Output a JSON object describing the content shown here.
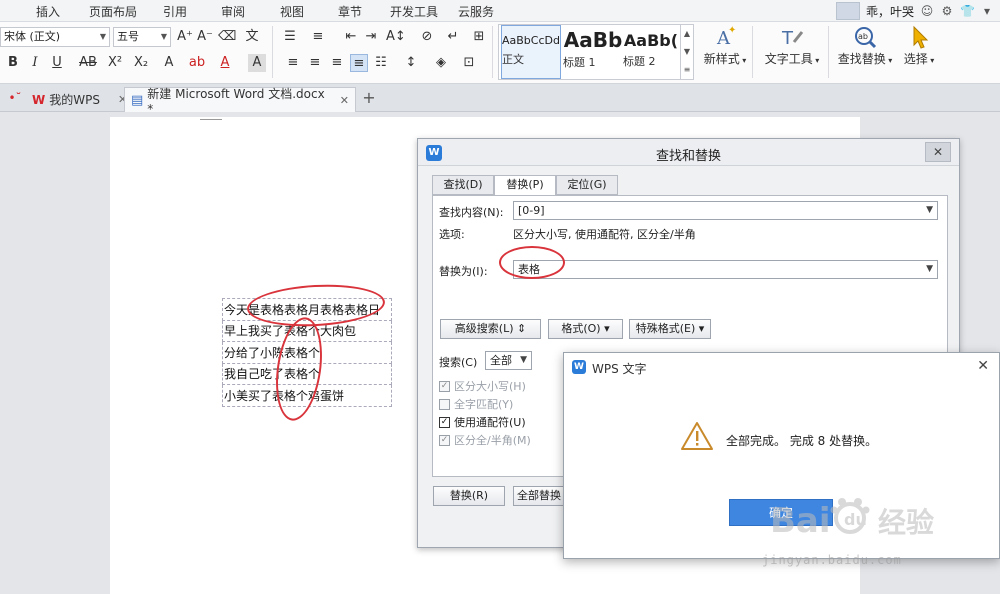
{
  "menu": {
    "items": [
      "插入",
      "页面布局",
      "引用",
      "审阅",
      "视图",
      "章节",
      "开发工具",
      "云服务"
    ],
    "user": "乖，叶哭"
  },
  "ribbon": {
    "font_name": "宋体 (正文)",
    "font_size": "五号",
    "styles": [
      {
        "sample": "AaBbCcDd",
        "label": "正文"
      },
      {
        "sample": "AaBb",
        "label": "标题 1"
      },
      {
        "sample": "AaBb(",
        "label": "标题 2"
      }
    ],
    "new_style": "新样式",
    "text_tools": "文字工具",
    "find_replace": "查找替换",
    "select": "选择"
  },
  "tabs": {
    "wps_home": "我的WPS",
    "document": "新建 Microsoft Word 文档.docx *",
    "add": "+"
  },
  "document": {
    "rows": [
      "今天是表格表格月表格表格日",
      "早上我买了表格个大肉包",
      "分给了小陈表格个",
      "我自己吃了表格个",
      "小美买了表格个鸡蛋饼"
    ]
  },
  "find_dialog": {
    "title": "查找和替换",
    "tab_find": "查找(D)",
    "tab_replace": "替换(P)",
    "tab_goto": "定位(G)",
    "find_label": "查找内容(N):",
    "find_value": "[0-9]",
    "options_label": "选项:",
    "options_value": "区分大小写, 使用通配符, 区分全/半角",
    "replace_label": "替换为(I):",
    "replace_value": "表格",
    "advanced_button": "高级搜索(L)",
    "format_button": "格式(O)",
    "special_button": "特殊格式(E)",
    "search_label": "搜索(C)",
    "search_value": "全部",
    "checkboxes": [
      {
        "label": "区分大小写(H)",
        "checked": true,
        "enabled": false
      },
      {
        "label": "全字匹配(Y)",
        "checked": false,
        "enabled": false
      },
      {
        "label": "使用通配符(U)",
        "checked": true,
        "enabled": true
      },
      {
        "label": "区分全/半角(M)",
        "checked": true,
        "enabled": false
      }
    ],
    "replace_button": "替换(R)",
    "replace_all_button": "全部替换"
  },
  "message_box": {
    "title": "WPS 文字",
    "text": "全部完成。 完成 8 处替换。",
    "ok": "确定"
  },
  "watermark": {
    "brand": "Baidu经验",
    "url": "jingyan.baidu.com"
  },
  "colors": {
    "accent": "#3f86e0",
    "annotation": "#d9343c",
    "wps_logo": "#2b7bd8",
    "wps_tab_red": "#d4262c"
  }
}
